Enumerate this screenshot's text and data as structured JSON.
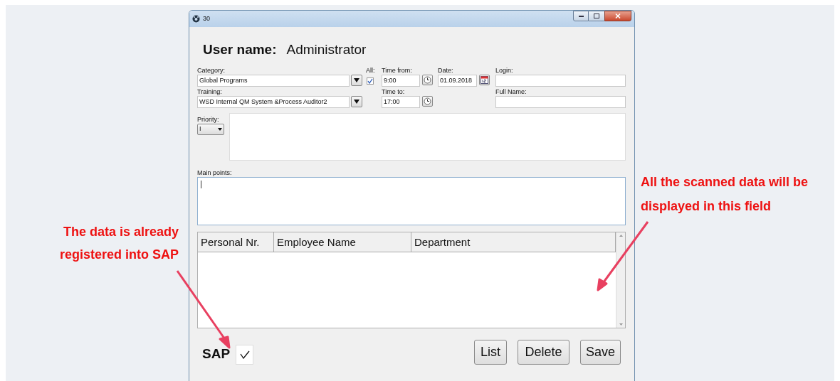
{
  "window": {
    "title": "30"
  },
  "user": {
    "label": "User name:",
    "value": "Administrator"
  },
  "category": {
    "label": "Category:",
    "value": "Global Programs"
  },
  "all": {
    "label": "All:",
    "checked": true
  },
  "time_from": {
    "label": "Time from:",
    "value": "9:00"
  },
  "date": {
    "label": "Date:",
    "value": "01.09.2018"
  },
  "login": {
    "label": "Login:"
  },
  "training": {
    "label": "Training:",
    "value": "WSD Internal QM System &Process Auditor2"
  },
  "time_to": {
    "label": "Time to:",
    "value": "17:00"
  },
  "full_name": {
    "label": "Full Name:"
  },
  "priority": {
    "label": "Priority:",
    "value": "I"
  },
  "main_points": {
    "label": "Main points:"
  },
  "table": {
    "columns": [
      "Personal Nr.",
      "Employee Name",
      "Department"
    ]
  },
  "sap": {
    "label": "SAP",
    "checked": true
  },
  "buttons": [
    "List",
    "Delete",
    "Save"
  ],
  "annotations": [
    {
      "text": "The data is already registered into SAP"
    },
    {
      "text": "All  the scanned data will be displayed in this field"
    }
  ]
}
